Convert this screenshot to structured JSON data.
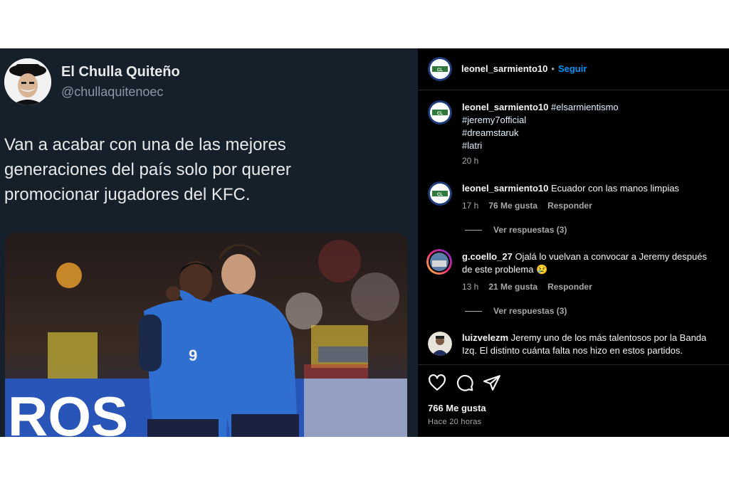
{
  "tweet": {
    "display_name": "El Chulla Quiteño",
    "handle": "@chullaquitenoec",
    "text_lines": [
      "Van a acabar con una de las mejores",
      "generaciones del país solo por querer",
      "promocionar jugadores del KFC."
    ],
    "photo": {
      "jersey_number": "9",
      "banner_text": "ROS"
    }
  },
  "instagram": {
    "header": {
      "username": "leonel_sarmiento10",
      "separator": "•",
      "follow_label": "Seguir"
    },
    "caption": {
      "username": "leonel_sarmiento10",
      "hashtags": [
        "#elsarmientismo",
        "#jeremy7official",
        "#dreamstaruk",
        "#latri"
      ],
      "time": "20 h"
    },
    "comments": [
      {
        "username": "leonel_sarmiento10",
        "text": "Ecuador con las manos limpias",
        "time": "17 h",
        "likes": "76 Me gusta",
        "reply_label": "Responder",
        "view_replies": "Ver respuestas (3)"
      },
      {
        "username": "g.coello_27",
        "text": "Ojalá lo vuelvan a convocar a Jeremy después",
        "text2": "de este problema",
        "emoji": "😢",
        "time": "13 h",
        "likes": "21 Me gusta",
        "reply_label": "Responder",
        "view_replies": "Ver respuestas (3)"
      },
      {
        "username": "luizvelezm",
        "text": "Jeremy uno de los más talentosos por la Banda",
        "text2": "Izq. El distinto cuánta falta nos hizo en estos partidos."
      }
    ],
    "actions": {
      "icons": [
        "heart-icon",
        "comment-icon",
        "share-icon"
      ],
      "likes": "766 Me gusta",
      "time_ago": "Hace 20 horas"
    }
  },
  "colors": {
    "twitter_bg": "#15202b",
    "instagram_bg": "#000000",
    "follow_blue": "#0095f6",
    "jersey_blue": "#2f6fd0"
  }
}
